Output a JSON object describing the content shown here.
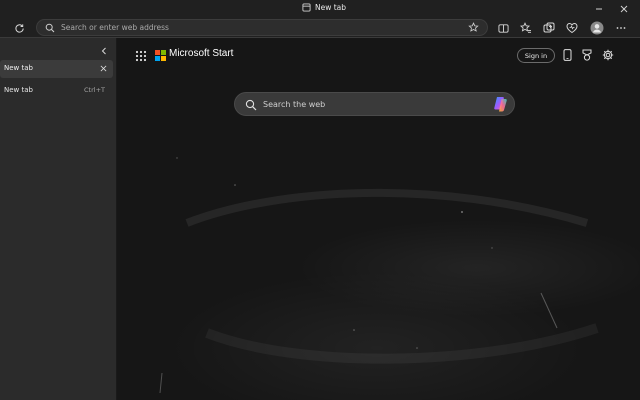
{
  "window": {
    "title": "New tab"
  },
  "toolbar": {
    "address_placeholder": "Search or enter web address"
  },
  "sidebar": {
    "tabs": [
      {
        "label": "New tab"
      }
    ],
    "new_tab_label": "New tab",
    "new_tab_shortcut": "Ctrl+T"
  },
  "page": {
    "brand": "Microsoft Start",
    "signin_label": "Sign in",
    "search_placeholder": "Search the web"
  },
  "colors": {
    "ms_red": "#f25022",
    "ms_green": "#7fba00",
    "ms_blue": "#00a4ef",
    "ms_yellow": "#ffb900"
  },
  "icons": [
    "tab-page-icon",
    "minimize-icon",
    "close-window-icon",
    "refresh-icon",
    "search-icon",
    "favorite-star-icon",
    "split-screen-icon",
    "favorites-icon",
    "collections-icon",
    "browser-essentials-icon",
    "profile-avatar-icon",
    "more-options-icon",
    "collapse-sidebar-icon",
    "close-tab-icon",
    "apps-grid-icon",
    "microsoft-logo-icon",
    "mobile-icon",
    "rewards-icon",
    "settings-gear-icon",
    "copilot-icon"
  ]
}
